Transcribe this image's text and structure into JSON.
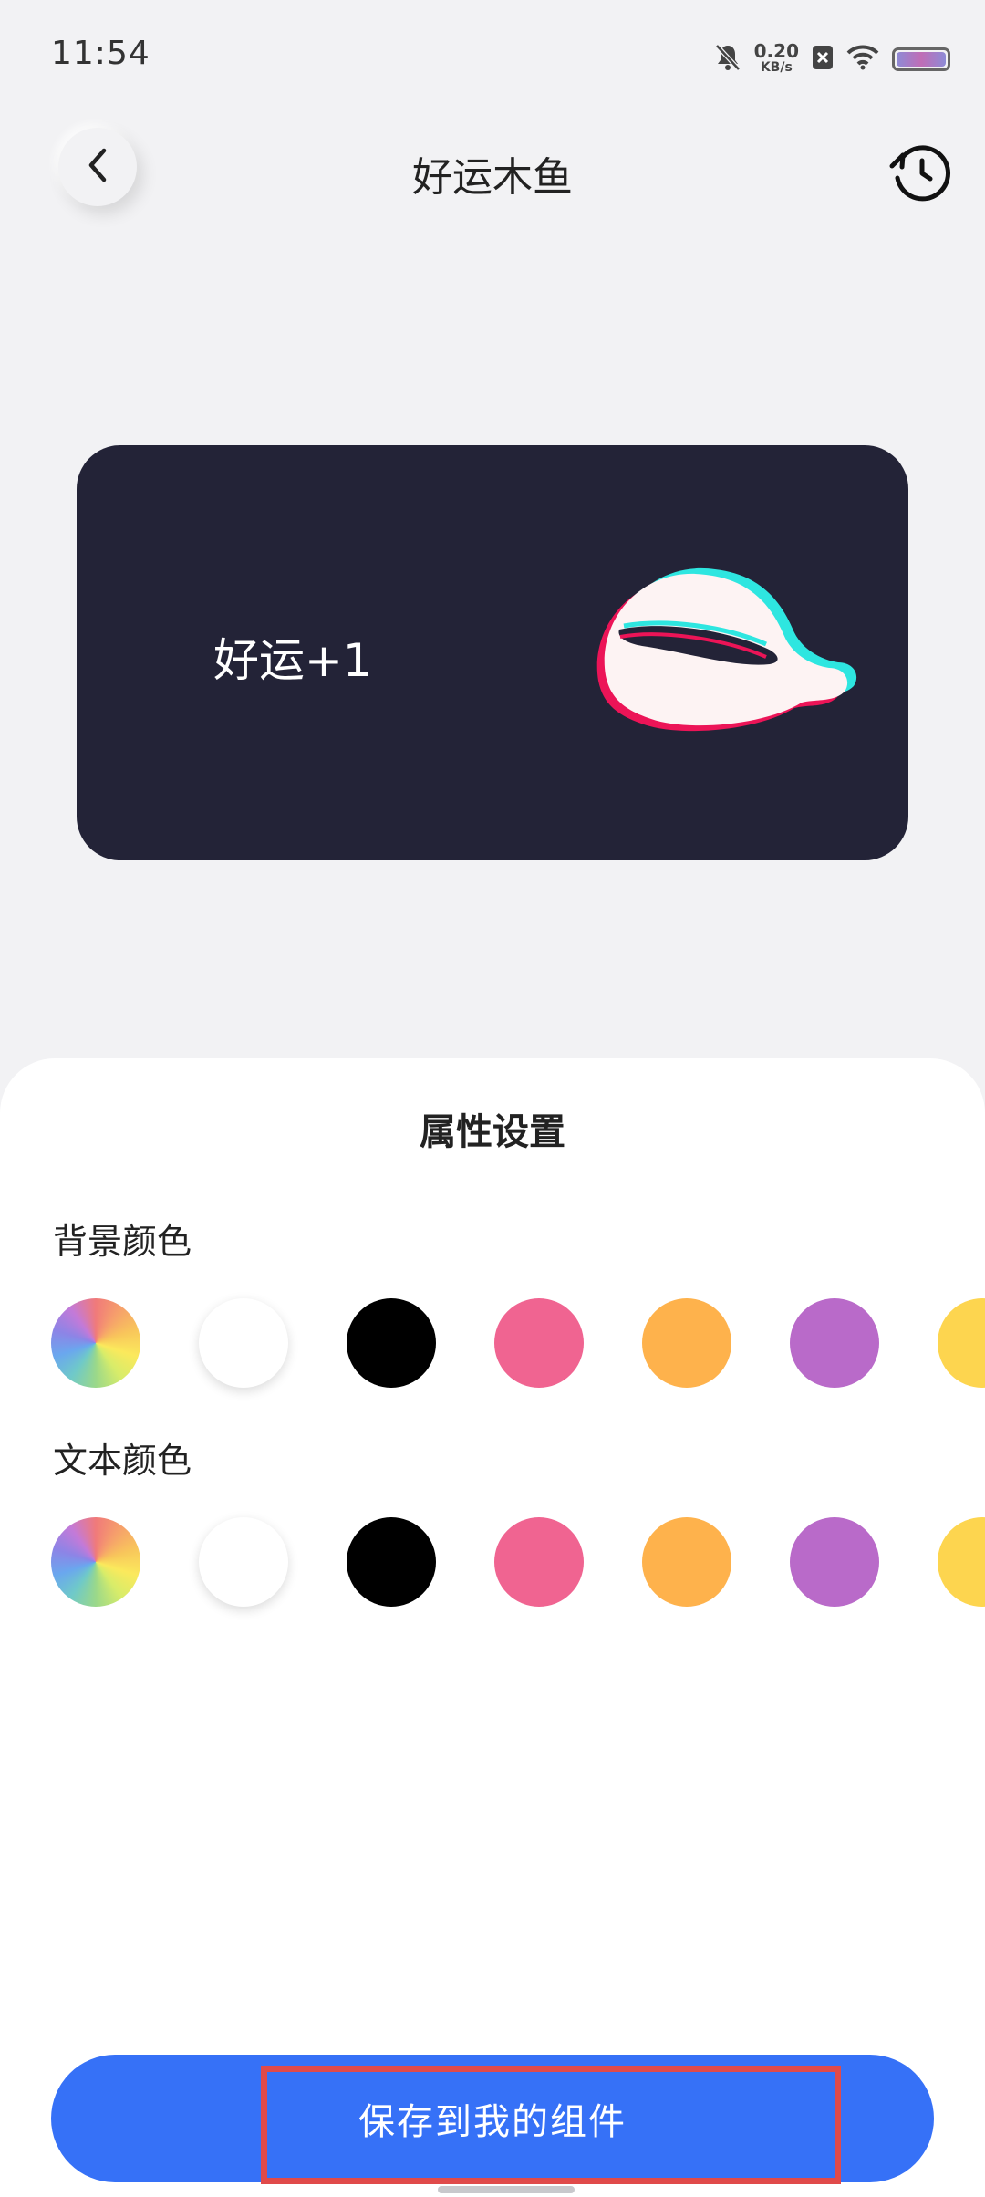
{
  "status_bar": {
    "time": "11:54",
    "net_speed_value": "0.20",
    "net_speed_unit": "KB/s",
    "battery_level": 1.0
  },
  "header": {
    "title": "好运木鱼"
  },
  "preview": {
    "text": "好运+1",
    "card_color": "#232337",
    "text_color": "#ffffff"
  },
  "settings": {
    "title": "属性设置",
    "background_color_label": "背景颜色",
    "text_color_label": "文本颜色",
    "swatches": [
      {
        "name": "custom-rainbow",
        "color": "rainbow"
      },
      {
        "name": "white",
        "color": "#ffffff"
      },
      {
        "name": "black",
        "color": "#000000"
      },
      {
        "name": "pink",
        "color": "#f06491"
      },
      {
        "name": "orange",
        "color": "#feb24c"
      },
      {
        "name": "purple",
        "color": "#b96ac9"
      },
      {
        "name": "yellow",
        "color": "#fdd54f"
      }
    ]
  },
  "footer": {
    "save_label": "保存到我的组件",
    "save_color": "#3671f7"
  }
}
